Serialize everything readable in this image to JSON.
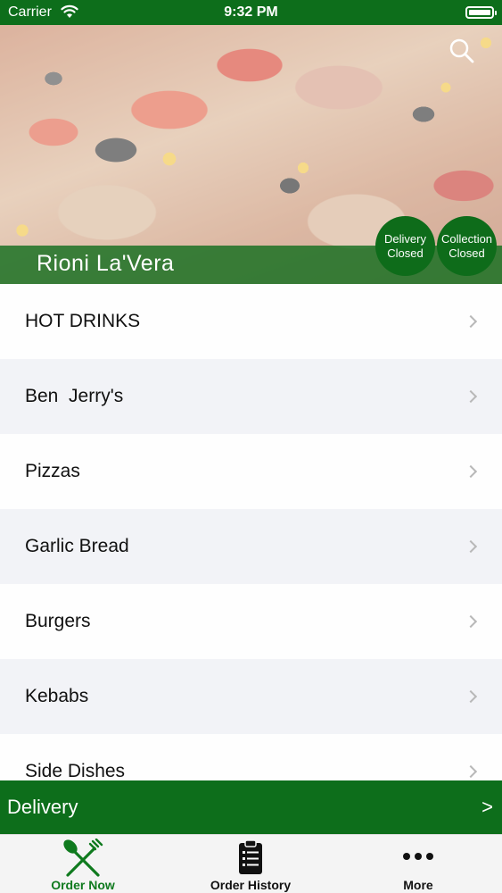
{
  "status_bar": {
    "carrier": "Carrier",
    "time": "9:32 PM"
  },
  "hero": {
    "restaurant_name": "Rioni La'Vera",
    "delivery_badge": {
      "line1": "Delivery",
      "line2": "Closed"
    },
    "collection_badge": {
      "line1": "Collection",
      "line2": "Closed"
    }
  },
  "menu": {
    "items": [
      {
        "label": "HOT DRINKS"
      },
      {
        "label": "Ben  Jerry's"
      },
      {
        "label": "Pizzas"
      },
      {
        "label": "Garlic Bread"
      },
      {
        "label": "Burgers"
      },
      {
        "label": "Kebabs"
      },
      {
        "label": "Side Dishes"
      }
    ]
  },
  "delivery_bar": {
    "label": "Delivery",
    "arrow": ">"
  },
  "tab_bar": {
    "tabs": [
      {
        "label": "Order Now"
      },
      {
        "label": "Order History"
      },
      {
        "label": "More"
      }
    ]
  },
  "colors": {
    "brand_green": "#0d6e1b",
    "active_tab": "#0f7a1e"
  }
}
